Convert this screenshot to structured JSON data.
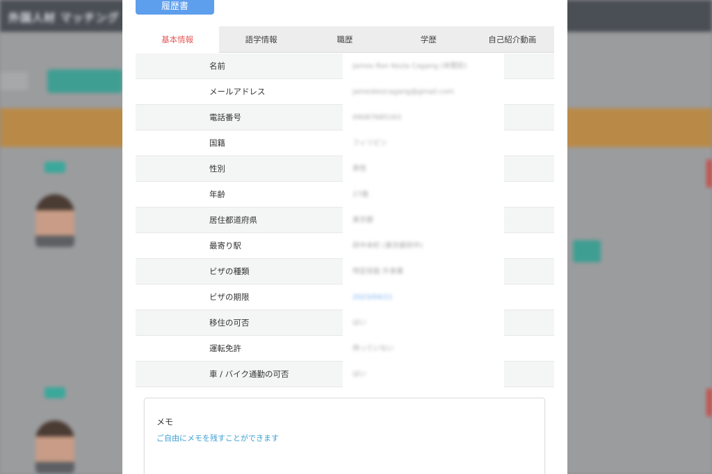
{
  "background": {
    "header_title": "外国人材 マッチング"
  },
  "resume_button": "履歴書",
  "tabs": [
    {
      "label": "基本情報",
      "active": true
    },
    {
      "label": "語学情報",
      "active": false
    },
    {
      "label": "職歴",
      "active": false
    },
    {
      "label": "学歴",
      "active": false
    },
    {
      "label": "自己紹介動画",
      "active": false
    }
  ],
  "info_rows": [
    {
      "label": "名前",
      "value": "James Ron Kezia Cagang (本間宏)"
    },
    {
      "label": "メールアドレス",
      "value": "jameskezcagang@gmail.com"
    },
    {
      "label": "電話番号",
      "value": "09087685163"
    },
    {
      "label": "国籍",
      "value": "フィリピン"
    },
    {
      "label": "性別",
      "value": "男性"
    },
    {
      "label": "年齢",
      "value": "27歳"
    },
    {
      "label": "居住都道府県",
      "value": "東京都"
    },
    {
      "label": "最寄り駅",
      "value": "府中本町 (東京都府中)"
    },
    {
      "label": "ビザの種類",
      "value": "特定技能 外食業"
    },
    {
      "label": "ビザの期限",
      "value": "2023/04/11"
    },
    {
      "label": "移住の可否",
      "value": "はい"
    },
    {
      "label": "運転免許",
      "value": "持っていない"
    },
    {
      "label": "車 / バイク通勤の可否",
      "value": "はい"
    }
  ],
  "memo": {
    "title": "メモ",
    "placeholder": "ご自由にメモを残すことができます"
  },
  "colors": {
    "active_tab": "#e35b5b",
    "resume_button": "#5d9eed",
    "memo_hint": "#3a9fd4"
  }
}
